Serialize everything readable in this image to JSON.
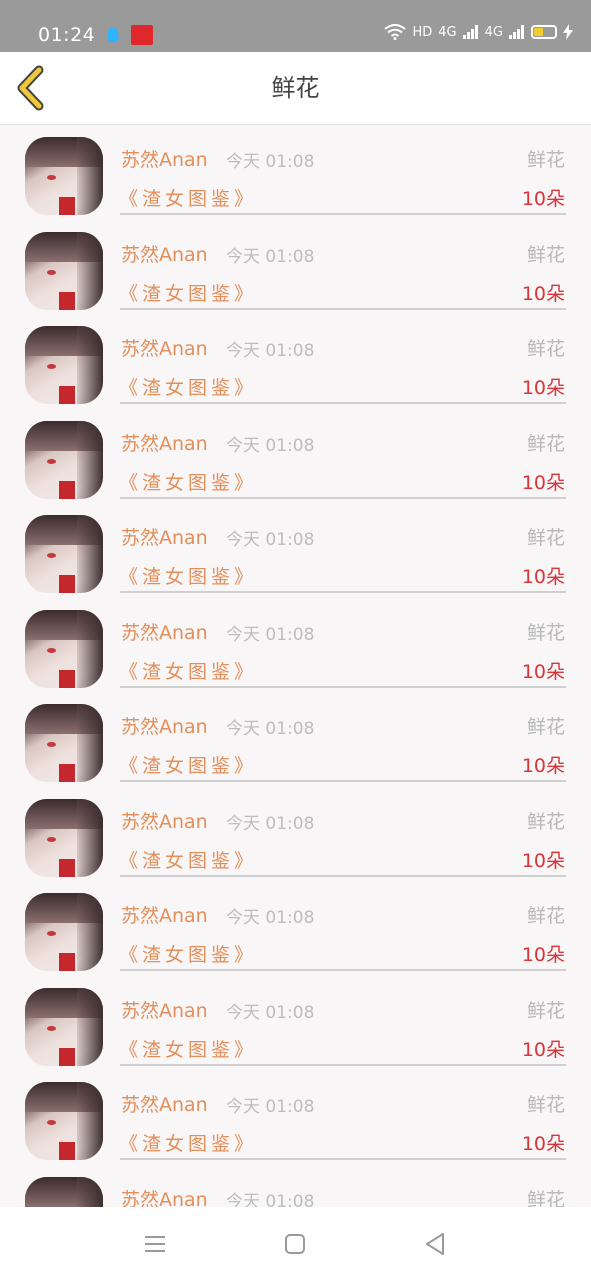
{
  "status": {
    "time": "01:24",
    "hd_label": "HD",
    "net1": "4G",
    "net2": "4G"
  },
  "header": {
    "title": "鲜花",
    "back_icon": "chevron-left-icon"
  },
  "items": [
    {
      "name": "苏然Anan",
      "time": "今天 01:08",
      "gift": "鲜花",
      "book": "《渣女图鉴》",
      "count": "10朵"
    },
    {
      "name": "苏然Anan",
      "time": "今天 01:08",
      "gift": "鲜花",
      "book": "《渣女图鉴》",
      "count": "10朵"
    },
    {
      "name": "苏然Anan",
      "time": "今天 01:08",
      "gift": "鲜花",
      "book": "《渣女图鉴》",
      "count": "10朵"
    },
    {
      "name": "苏然Anan",
      "time": "今天 01:08",
      "gift": "鲜花",
      "book": "《渣女图鉴》",
      "count": "10朵"
    },
    {
      "name": "苏然Anan",
      "time": "今天 01:08",
      "gift": "鲜花",
      "book": "《渣女图鉴》",
      "count": "10朵"
    },
    {
      "name": "苏然Anan",
      "time": "今天 01:08",
      "gift": "鲜花",
      "book": "《渣女图鉴》",
      "count": "10朵"
    },
    {
      "name": "苏然Anan",
      "time": "今天 01:08",
      "gift": "鲜花",
      "book": "《渣女图鉴》",
      "count": "10朵"
    },
    {
      "name": "苏然Anan",
      "time": "今天 01:08",
      "gift": "鲜花",
      "book": "《渣女图鉴》",
      "count": "10朵"
    },
    {
      "name": "苏然Anan",
      "time": "今天 01:08",
      "gift": "鲜花",
      "book": "《渣女图鉴》",
      "count": "10朵"
    },
    {
      "name": "苏然Anan",
      "time": "今天 01:08",
      "gift": "鲜花",
      "book": "《渣女图鉴》",
      "count": "10朵"
    },
    {
      "name": "苏然Anan",
      "time": "今天 01:08",
      "gift": "鲜花",
      "book": "《渣女图鉴》",
      "count": "10朵"
    },
    {
      "name": "苏然Anan",
      "time": "今天 01:08",
      "gift": "鲜花"
    }
  ],
  "nav": {
    "menu_icon": "menu-icon",
    "home_icon": "square-home-icon",
    "back_icon": "triangle-back-icon"
  },
  "colors": {
    "accent_orange": "#e38f5b",
    "count_red": "#d8353a",
    "back_arrow": "#f0c93a",
    "status_bar": "#9a9a9a"
  }
}
